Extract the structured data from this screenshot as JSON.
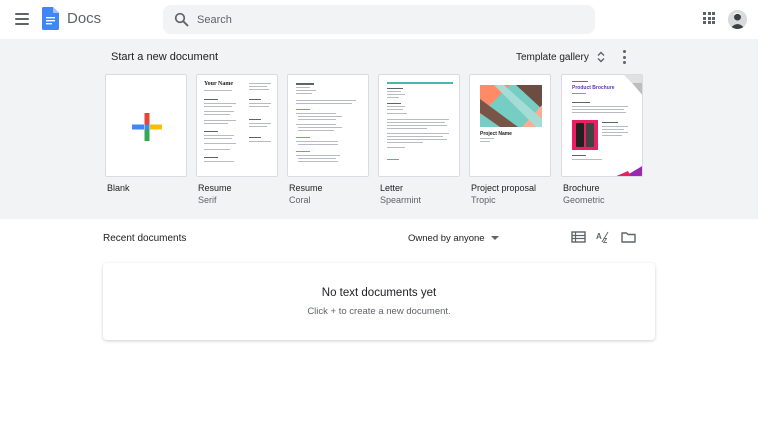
{
  "header": {
    "app_title": "Docs",
    "search_placeholder": "Search"
  },
  "templates_section": {
    "title": "Start a new document",
    "gallery_label": "Template gallery",
    "templates": [
      {
        "name": "Blank",
        "subtitle": ""
      },
      {
        "name": "Resume",
        "subtitle": "Serif",
        "thumb_heading": "Your Name"
      },
      {
        "name": "Resume",
        "subtitle": "Coral"
      },
      {
        "name": "Letter",
        "subtitle": "Spearmint"
      },
      {
        "name": "Project proposal",
        "subtitle": "Tropic",
        "thumb_heading": "Project Name"
      },
      {
        "name": "Brochure",
        "subtitle": "Geometric",
        "thumb_heading": "Product Brochure"
      }
    ]
  },
  "recent": {
    "title": "Recent documents",
    "owner_filter": "Owned by anyone",
    "empty_title": "No text documents yet",
    "empty_subtitle": "Click + to create a new document."
  },
  "icons": {
    "menu": "hamburger-menu-icon",
    "search": "search-icon",
    "apps": "apps-grid-icon",
    "list_view": "list-view-icon",
    "sort": "sort-az-icon",
    "folder": "folder-icon"
  },
  "colors": {
    "docs_blue": "#4285f4",
    "band_bg": "#f1f3f4",
    "plus_red": "#ea4335",
    "plus_blue": "#4285f4",
    "plus_yellow": "#fbbc04",
    "plus_green": "#34a853",
    "brochure_accent": "#9c27b0"
  }
}
